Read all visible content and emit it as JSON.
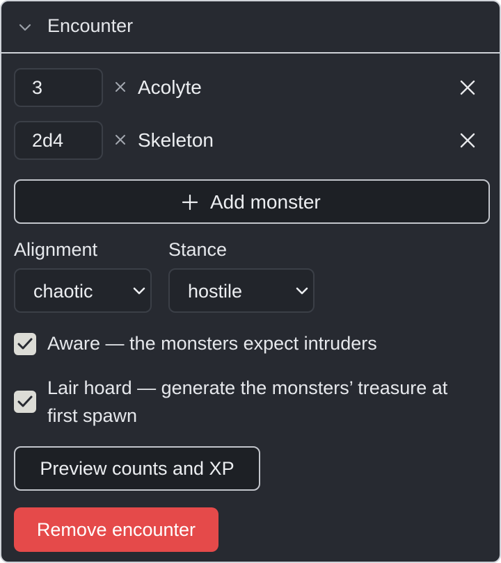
{
  "header": {
    "title": "Encounter"
  },
  "monsters": [
    {
      "count": "3",
      "name": "Acolyte"
    },
    {
      "count": "2d4",
      "name": "Skeleton"
    }
  ],
  "add_monster_label": "Add monster",
  "alignment": {
    "label": "Alignment",
    "value": "chaotic"
  },
  "stance": {
    "label": "Stance",
    "value": "hostile"
  },
  "options": {
    "aware": {
      "label": "Aware — the monsters expect intruders",
      "checked": true
    },
    "lair_hoard": {
      "label_line1": "Lair hoard — generate the monsters’ treasure at",
      "label_line2": "first spawn",
      "checked": true
    }
  },
  "preview_label": "Preview counts and XP",
  "remove_encounter_label": "Remove encounter",
  "colors": {
    "panel_bg": "#272a31",
    "danger": "#e54a4a",
    "checkbox": "#dcdcd6"
  }
}
